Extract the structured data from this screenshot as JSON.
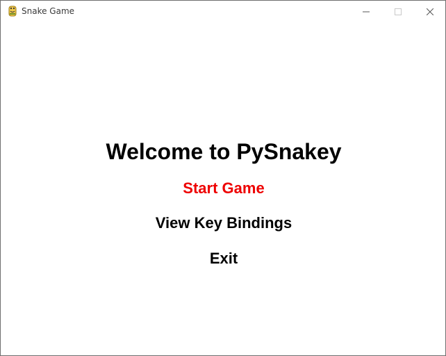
{
  "window": {
    "title": "Snake Game",
    "app_icon": "python-icon"
  },
  "controls": {
    "minimize_icon": "minimize-icon",
    "maximize_icon": "maximize-icon",
    "close_icon": "close-icon"
  },
  "menu": {
    "title": "Welcome to PySnakey",
    "items": [
      {
        "label": "Start Game",
        "selected": true
      },
      {
        "label": "View Key Bindings",
        "selected": false
      },
      {
        "label": "Exit",
        "selected": false
      }
    ]
  },
  "colors": {
    "selected": "#ee0000",
    "normal": "#000000",
    "background": "#ffffff"
  }
}
